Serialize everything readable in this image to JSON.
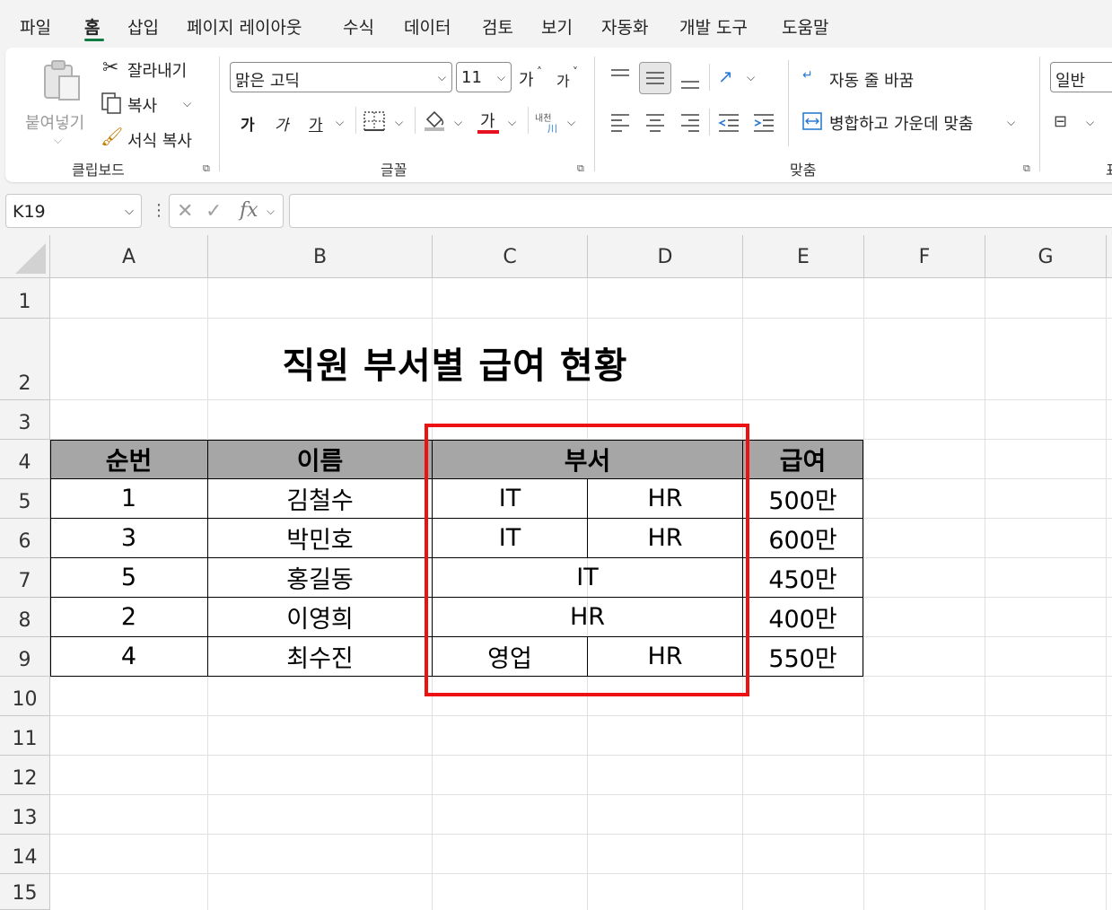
{
  "menu": [
    "파일",
    "홈",
    "삽입",
    "페이지 레이아웃",
    "수식",
    "데이터",
    "검토",
    "보기",
    "자동화",
    "개발 도구",
    "도움말"
  ],
  "menu_active": "홈",
  "ribbon": {
    "clipboard": {
      "paste": "붙여넣기",
      "cut": "잘라내기",
      "copy": "복사",
      "format_painter": "서식 복사",
      "label": "클립보드"
    },
    "font": {
      "font_name": "맑은 고딕",
      "font_size": "11",
      "grow": "가",
      "shrink": "가",
      "bold": "가",
      "italic": "가",
      "underline": "가",
      "font_color": "가",
      "phonetic_top": "내천",
      "phonetic_bottom": "川",
      "label": "글꼴"
    },
    "alignment": {
      "wrap_text": "자동 줄 바꿈",
      "merge_center": "병합하고 가운데 맞춤",
      "label": "맞춤"
    },
    "number": {
      "format": "일반",
      "label_partial": "표"
    }
  },
  "formula_bar": {
    "name_box": "K19",
    "fx": "fx",
    "value": ""
  },
  "sheet": {
    "columns": [
      "A",
      "B",
      "C",
      "D",
      "E",
      "F",
      "G"
    ],
    "rows": [
      "1",
      "2",
      "3",
      "4",
      "5",
      "6",
      "7",
      "8",
      "9",
      "10",
      "11",
      "12",
      "13",
      "14",
      "15"
    ],
    "title": "직원 부서별 급여 현황",
    "table": {
      "headers": {
        "no": "순번",
        "name": "이름",
        "dept": "부서",
        "salary": "급여"
      },
      "rows": [
        {
          "no": "1",
          "name": "김철수",
          "dept1": "IT",
          "dept2": "HR",
          "salary": "500만"
        },
        {
          "no": "3",
          "name": "박민호",
          "dept1": "IT",
          "dept2": "HR",
          "salary": "600만"
        },
        {
          "no": "5",
          "name": "홍길동",
          "dept_merged": "IT",
          "salary": "450만"
        },
        {
          "no": "2",
          "name": "이영희",
          "dept_merged": "HR",
          "salary": "400만"
        },
        {
          "no": "4",
          "name": "최수진",
          "dept1": "영업",
          "dept2": "HR",
          "salary": "550만"
        }
      ]
    }
  },
  "colors": {
    "accent": "#107c41",
    "header_fill": "#a6a6a6",
    "highlight": "#ee1111",
    "font_color_bar": "#e81123"
  }
}
